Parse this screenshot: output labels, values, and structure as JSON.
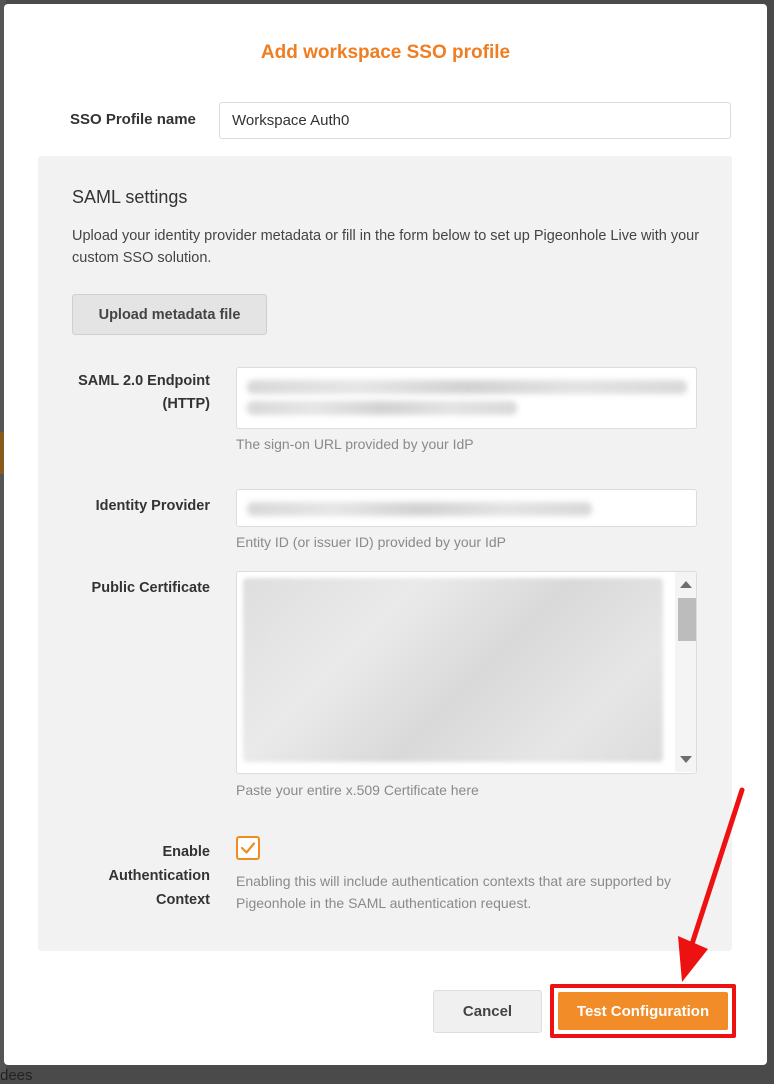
{
  "modal": {
    "title": "Add workspace SSO profile",
    "profile_label": "SSO Profile name",
    "profile_value": "Workspace Auth0"
  },
  "saml": {
    "title": "SAML settings",
    "description": "Upload your identity provider metadata or fill in the form below to set up Pigeonhole Live with your custom SSO solution.",
    "upload_label": "Upload metadata file",
    "endpoint_label_line1": "SAML 2.0 Endpoint",
    "endpoint_label_line2": "(HTTP)",
    "endpoint_help": "The sign-on URL provided by your IdP",
    "idp_label": "Identity Provider",
    "idp_help": "Entity ID (or issuer ID) provided by your IdP",
    "cert_label": "Public Certificate",
    "cert_help": "Paste your entire x.509 Certificate here",
    "auth_label_line1": "Enable",
    "auth_label_line2": "Authentication",
    "auth_label_line3": "Context",
    "auth_checked": true,
    "auth_help": "Enabling this will include authentication contexts that are supported by Pigeonhole in the SAML authentication request."
  },
  "footer": {
    "cancel_label": "Cancel",
    "test_label": "Test Configuration"
  },
  "background": {
    "partial_text": "dees"
  },
  "colors": {
    "accent": "#ef7d22",
    "primary_button": "#f28c28",
    "annotation": "#ee1111"
  },
  "icons": {
    "checkbox": "check-icon",
    "annotation": "red-arrow-icon"
  }
}
